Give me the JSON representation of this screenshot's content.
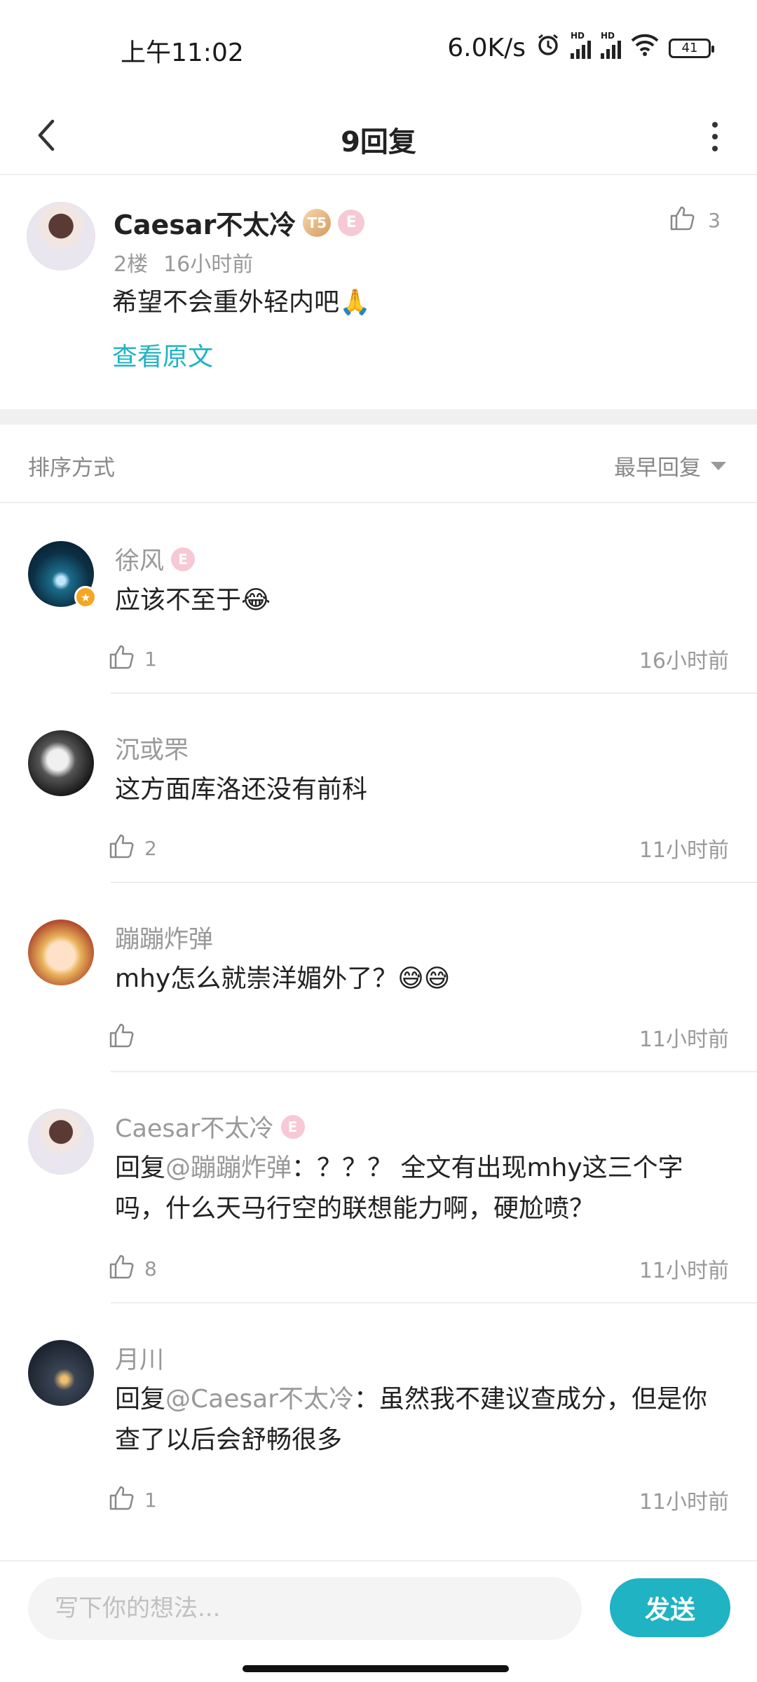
{
  "status_bar": {
    "time": "上午11:02",
    "network_speed": "6.0K/s",
    "signal_label": "HD",
    "battery": "41"
  },
  "header": {
    "title": "9回复",
    "back_icon": "chevron-left-icon",
    "more_icon": "more-vertical-icon"
  },
  "main_comment": {
    "author": "Caesar不太冷",
    "badge_level": "T5",
    "badge_e": "E",
    "floor": "2楼",
    "time": "16小时前",
    "text": "希望不会重外轻内吧🙏",
    "view_original": "查看原文",
    "likes": "3"
  },
  "sort": {
    "label": "排序方式",
    "value": "最早回复"
  },
  "replies": [
    {
      "author": "徐风",
      "badge": "E",
      "text": "应该不至于😂",
      "mention": "",
      "likes": "1",
      "time": "16小时前"
    },
    {
      "author": "沉或罘",
      "badge": "",
      "text": "这方面库洛还没有前科",
      "mention": "",
      "likes": "2",
      "time": "11小时前"
    },
    {
      "author": "蹦蹦炸弹",
      "badge": "",
      "text": "mhy怎么就崇洋媚外了？😅😅",
      "mention": "",
      "likes": "",
      "time": "11小时前"
    },
    {
      "author": "Caesar不太冷",
      "badge": "E",
      "reply_prefix": "回复",
      "mention": "@蹦蹦炸弹",
      "text": "：？？？ 全文有出现mhy这三个字吗，什么天马行空的联想能力啊，硬尬喷？",
      "likes": "8",
      "time": "11小时前"
    },
    {
      "author": "月川",
      "badge": "",
      "reply_prefix": "回复",
      "mention": "@Caesar不太冷",
      "text": "：虽然我不建议查成分，但是你查了以后会舒畅很多",
      "likes": "1",
      "time": "11小时前"
    }
  ],
  "composer": {
    "placeholder": "写下你的想法...",
    "send_label": "发送"
  },
  "colors": {
    "accent": "#1fb3c3",
    "muted": "#999999",
    "divider": "#eeeeee"
  }
}
